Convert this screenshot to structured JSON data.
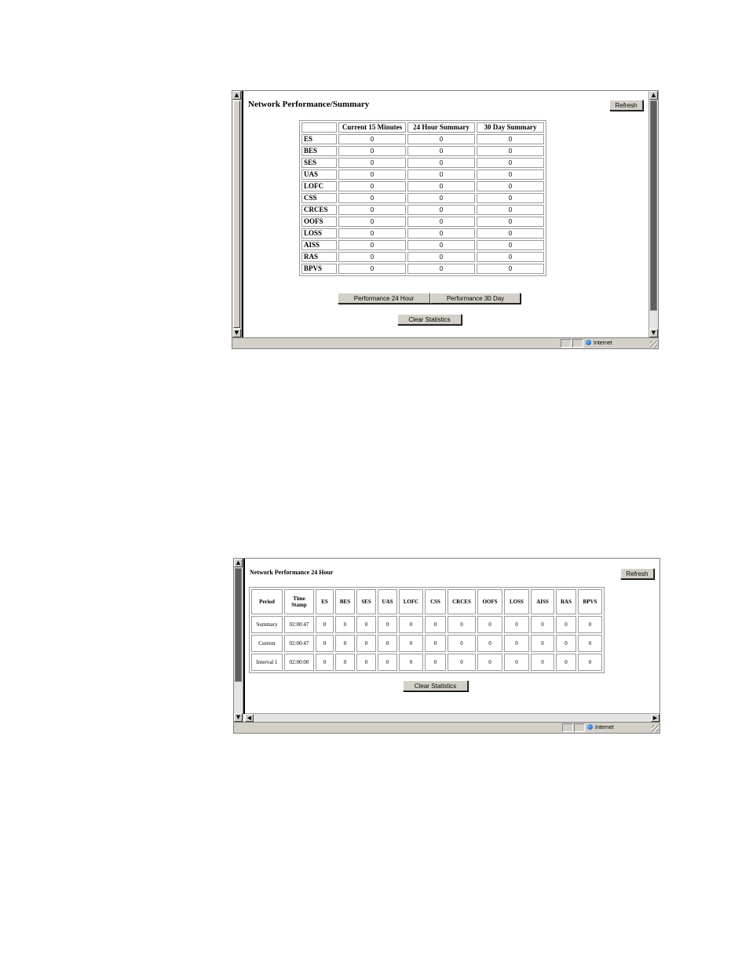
{
  "summary_window": {
    "title": "Network Performance/Summary",
    "refresh_label": "Refresh",
    "columns": [
      "",
      "Current 15 Minutes",
      "24 Hour Summary",
      "30 Day Summary"
    ],
    "rows": [
      {
        "label": "ES",
        "values": [
          "0",
          "0",
          "0"
        ]
      },
      {
        "label": "BES",
        "values": [
          "0",
          "0",
          "0"
        ]
      },
      {
        "label": "SES",
        "values": [
          "0",
          "0",
          "0"
        ]
      },
      {
        "label": "UAS",
        "values": [
          "0",
          "0",
          "0"
        ]
      },
      {
        "label": "LOFC",
        "values": [
          "0",
          "0",
          "0"
        ]
      },
      {
        "label": "CSS",
        "values": [
          "0",
          "0",
          "0"
        ]
      },
      {
        "label": "CRCES",
        "values": [
          "0",
          "0",
          "0"
        ]
      },
      {
        "label": "OOFS",
        "values": [
          "0",
          "0",
          "0"
        ]
      },
      {
        "label": "LOSS",
        "values": [
          "0",
          "0",
          "0"
        ]
      },
      {
        "label": "AISS",
        "values": [
          "0",
          "0",
          "0"
        ]
      },
      {
        "label": "RAS",
        "values": [
          "0",
          "0",
          "0"
        ]
      },
      {
        "label": "BPVS",
        "values": [
          "0",
          "0",
          "0"
        ]
      }
    ],
    "perf24_label": "Performance 24 Hour",
    "perf30_label": "Performance 30 Day",
    "clear_label": "Clear Statistics",
    "status_zone": "Internet"
  },
  "hour24_window": {
    "title": "Network Performance 24 Hour",
    "refresh_label": "Refresh",
    "columns": [
      "Period",
      "Time Stamp",
      "ES",
      "BES",
      "SES",
      "UAS",
      "LOFC",
      "CSS",
      "CRCES",
      "OOFS",
      "LOSS",
      "AISS",
      "RAS",
      "BPVS"
    ],
    "rows": [
      {
        "period": "Summary",
        "timestamp": "02:00:47",
        "values": [
          "0",
          "0",
          "0",
          "0",
          "0",
          "0",
          "0",
          "0",
          "0",
          "0",
          "0",
          "0"
        ]
      },
      {
        "period": "Current",
        "timestamp": "02:00:47",
        "values": [
          "0",
          "0",
          "0",
          "0",
          "0",
          "0",
          "0",
          "0",
          "0",
          "0",
          "0",
          "0"
        ]
      },
      {
        "period": "Interval 1",
        "timestamp": "02:00:00",
        "values": [
          "0",
          "0",
          "0",
          "0",
          "0",
          "0",
          "0",
          "0",
          "0",
          "0",
          "0",
          "0"
        ]
      }
    ],
    "clear_label": "Clear Statistics",
    "status_zone": "Internet"
  },
  "icons": {
    "scroll_up": "▲",
    "scroll_down": "▼",
    "scroll_left": "◀",
    "scroll_right": "▶"
  }
}
